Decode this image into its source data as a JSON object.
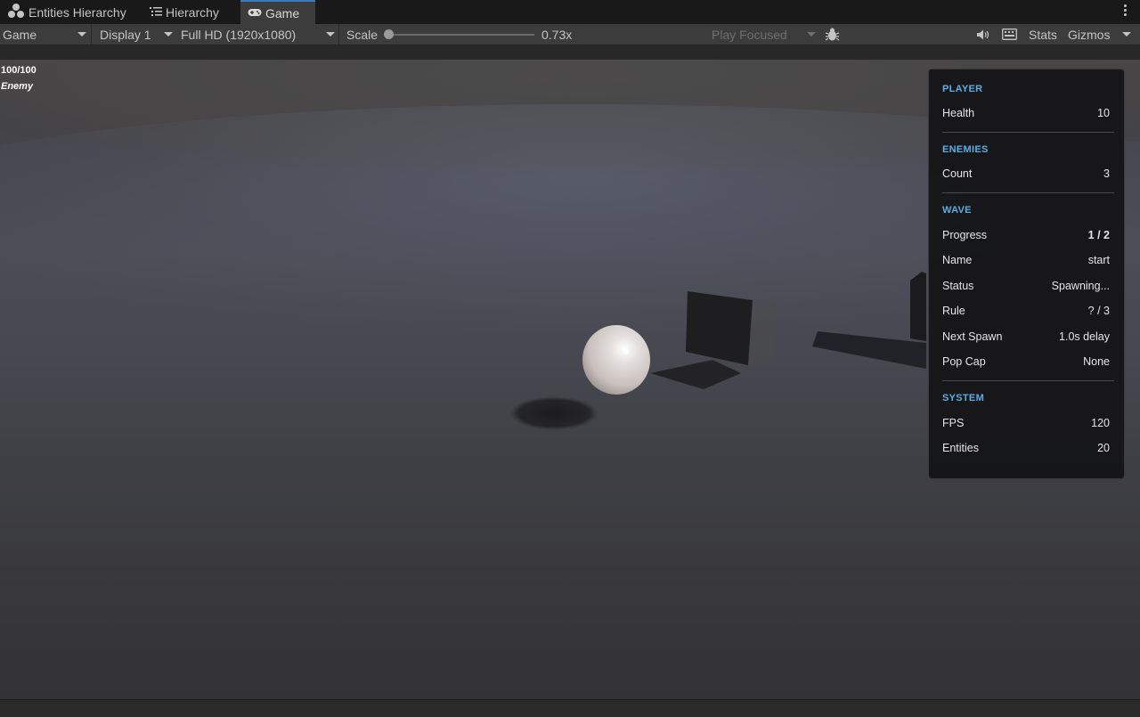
{
  "tabs": [
    {
      "label": "Entities Hierarchy",
      "icon": "entities-icon"
    },
    {
      "label": "Hierarchy",
      "icon": "hierarchy-list-icon"
    },
    {
      "label": "Game",
      "icon": "gamepad-icon",
      "active": true
    }
  ],
  "toolbar": {
    "view_mode": "Game",
    "display": "Display 1",
    "resolution": "Full HD (1920x1080)",
    "scale_label": "Scale",
    "scale_value": "0.73x",
    "play_focused": "Play Focused",
    "stats": "Stats",
    "gizmos": "Gizmos"
  },
  "hud": {
    "health": "100/100",
    "target": "Enemy"
  },
  "panel": {
    "player": {
      "title": "PLAYER",
      "health_label": "Health",
      "health_value": "10"
    },
    "enemies": {
      "title": "ENEMIES",
      "count_label": "Count",
      "count_value": "3"
    },
    "wave": {
      "title": "WAVE",
      "progress_label": "Progress",
      "progress_value": "1 / 2",
      "name_label": "Name",
      "name_value": "start",
      "status_label": "Status",
      "status_value": "Spawning...",
      "rule_label": "Rule",
      "rule_value": "? / 3",
      "next_spawn_label": "Next Spawn",
      "next_spawn_value": "1.0s delay",
      "pop_cap_label": "Pop Cap",
      "pop_cap_value": "None"
    },
    "system": {
      "title": "SYSTEM",
      "fps_label": "FPS",
      "fps_value": "120",
      "entities_label": "Entities",
      "entities_value": "20"
    }
  },
  "colors": {
    "accent": "#5aaee6",
    "tab_highlight": "#3a79bb"
  }
}
